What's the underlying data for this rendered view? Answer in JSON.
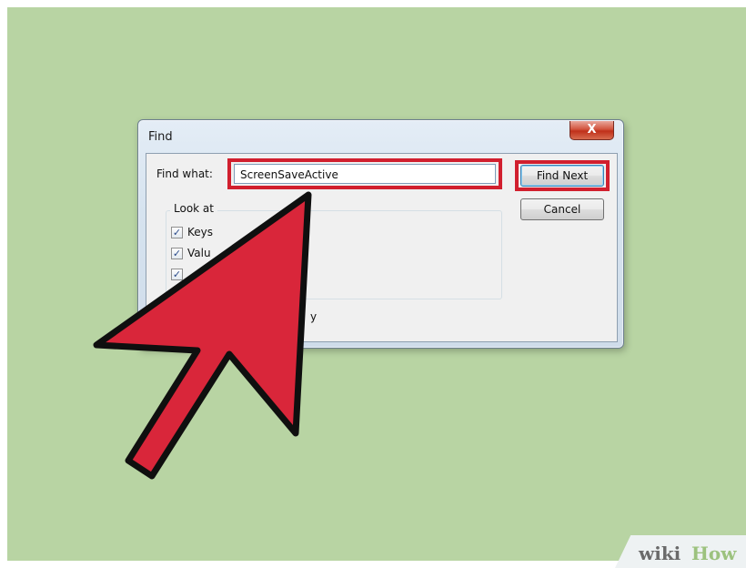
{
  "dialog": {
    "title": "Find",
    "close_glyph": "X",
    "find_what_label": "Find what:",
    "find_value": "ScreenSaveActive",
    "find_next_label": "Find Next",
    "cancel_label": "Cancel",
    "look_at_label": "Look at",
    "options": [
      {
        "label": "Keys",
        "checked": true
      },
      {
        "label": "Valu",
        "checked": true
      },
      {
        "label": "",
        "checked": true
      }
    ],
    "match_fragment": "y"
  },
  "annotation": {
    "highlight_color": "#d11f2e",
    "arrow_color": "#d9263a",
    "icon": "cursor-arrow-icon"
  },
  "watermark": {
    "part1": "wiki",
    "part2": "How"
  },
  "colors": {
    "background": "#b8d4a3"
  }
}
